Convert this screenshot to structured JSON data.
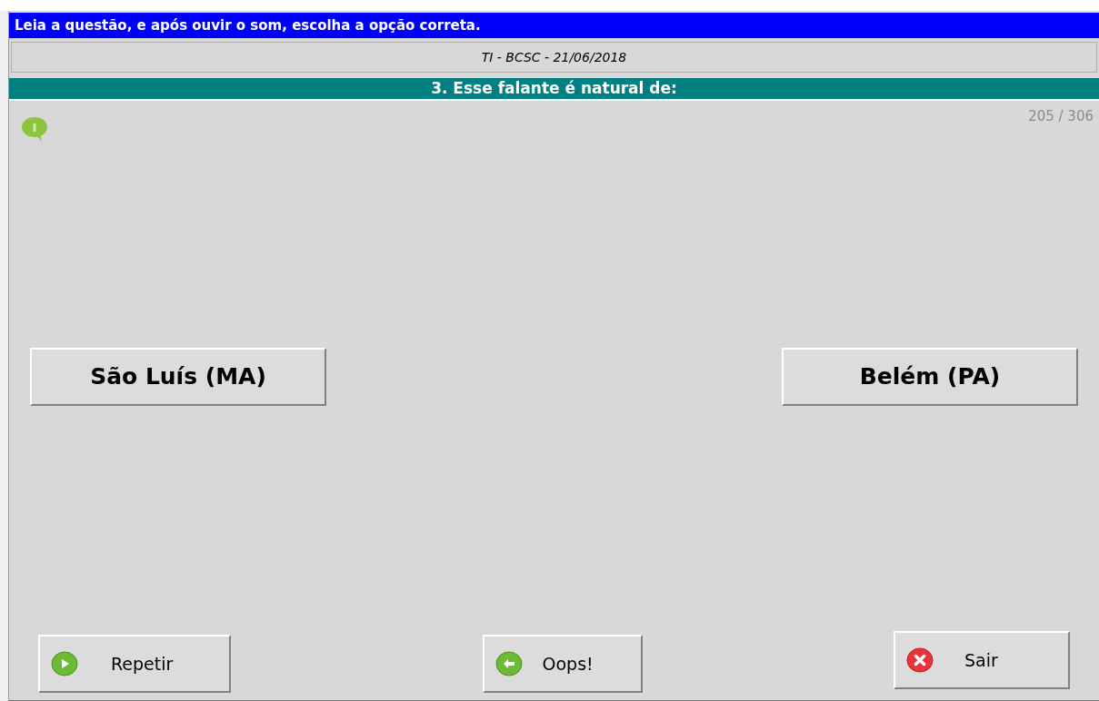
{
  "instruction": "Leia a questão, e após ouvir o som, escolha a opção correta.",
  "test_title": "TI - BCSC - 21/06/2018",
  "question": "3. Esse falante é natural de:",
  "counter": "205 / 306",
  "options": [
    {
      "label": "São Luís (MA)"
    },
    {
      "label": "Belém (PA)"
    }
  ],
  "buttons": [
    {
      "label": "Repetir",
      "kind": "play"
    },
    {
      "label": "Oops!",
      "kind": "back"
    },
    {
      "label": "Sair",
      "kind": "exit"
    }
  ]
}
